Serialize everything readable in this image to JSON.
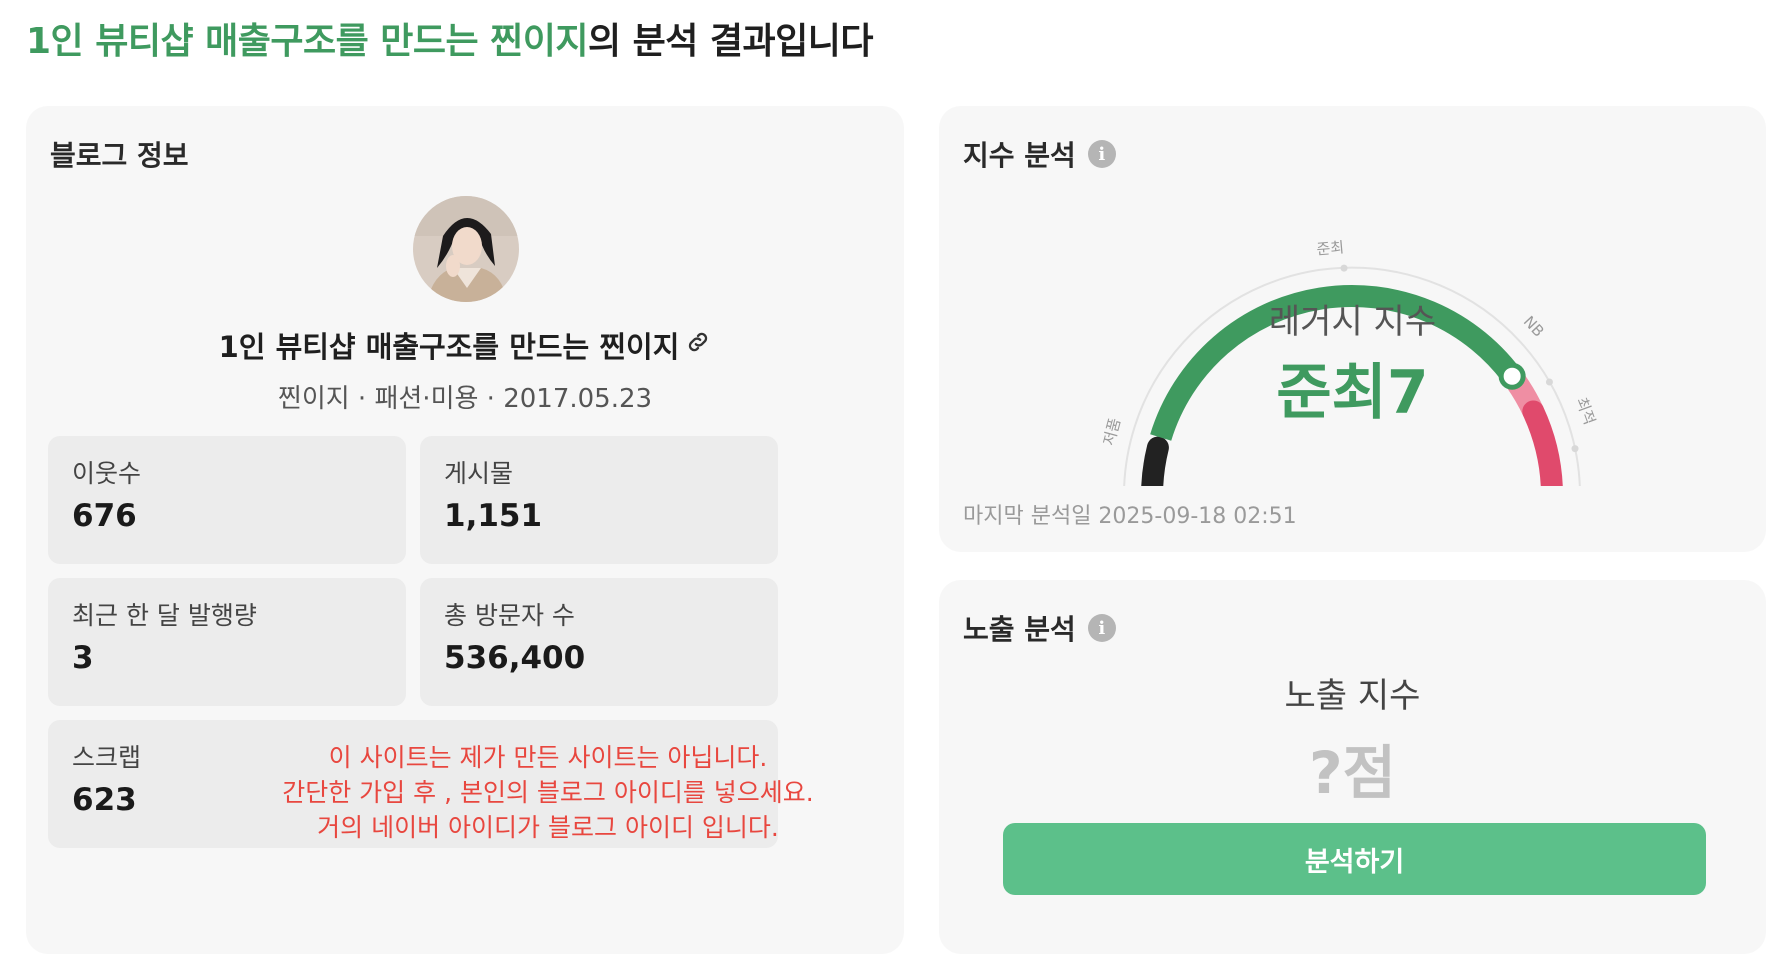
{
  "header": {
    "title_highlight": "1인 뷰티샵 매출구조를 만드는 찐이지",
    "title_rest": "의 분석 결과입니다"
  },
  "blog_info": {
    "title": "블로그 정보",
    "name": "1인 뷰티샵 매출구조를 만드는 찐이지",
    "meta": "찐이지 · 패션·미용 · 2017.05.23",
    "stats": [
      {
        "label": "이웃수",
        "value": "676"
      },
      {
        "label": "게시물",
        "value": "1,151"
      },
      {
        "label": "최근 한 달 발행량",
        "value": "3"
      },
      {
        "label": "총 방문자 수",
        "value": "536,400"
      }
    ],
    "scrap": {
      "label": "스크랩",
      "value": "623"
    },
    "notice": [
      "이 사이트는 제가 만든 사이트는 아닙니다.",
      "간단한 가입 후 , 본인의 블로그 아이디를 넣으세요.",
      "거의 네이버 아이디가 블로그 아이디 입니다."
    ]
  },
  "index_analysis": {
    "title": "지수 분석",
    "info_icon": "i",
    "gauge_label": "레거시 지수",
    "gauge_value": "준최7",
    "gauge_ticks": [
      "저품",
      "준최",
      "NB",
      "최적"
    ],
    "gauge_position": 0.78,
    "last_analysis": "마지막 분석일 2025-09-18 02:51",
    "colors": {
      "dark": "#222222",
      "green": "#3f9a5f",
      "pink": "#ef8ea3",
      "red": "#e04a6c"
    }
  },
  "exposure_analysis": {
    "title": "노출 분석",
    "info_icon": "i",
    "label": "노출 지수",
    "value": "?점",
    "button": "분석하기"
  }
}
